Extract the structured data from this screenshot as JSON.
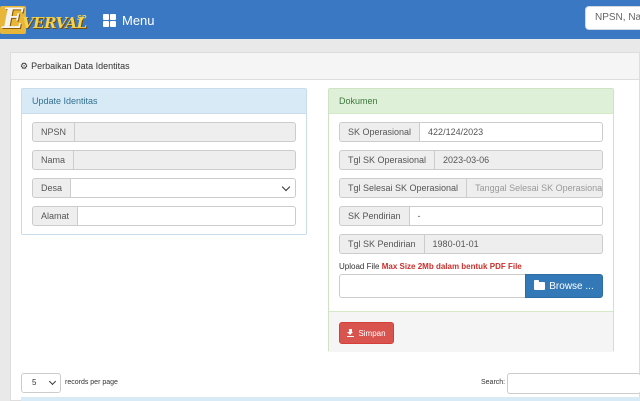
{
  "navbar": {
    "logo_letter": "E",
    "logo_text": "VERVAL",
    "logo_sup": "SP",
    "menu_label": "Menu",
    "search_placeholder": "NPSN, Nama"
  },
  "page": {
    "heading": "Perbaikan Data Identitas"
  },
  "update_identitas": {
    "title": "Update Identitas",
    "fields": [
      {
        "label": "NPSN",
        "value": ""
      },
      {
        "label": "Nama",
        "value": ""
      },
      {
        "label": "Desa",
        "value": ""
      },
      {
        "label": "Alamat",
        "value": ""
      }
    ]
  },
  "dokumen": {
    "title": "Dokumen",
    "fields": [
      {
        "label": "SK Operasional",
        "value": "422/124/2023"
      },
      {
        "label": "Tgl SK Operasional",
        "value": "2023-03-06"
      },
      {
        "label": "Tgl Selesai SK Operasional",
        "placeholder": "Tanggal Selesai SK Operasional..."
      },
      {
        "label": "SK Pendirian",
        "value": "-"
      },
      {
        "label": "Tgl SK Pendirian",
        "value": "1980-01-01"
      }
    ],
    "upload_label": "Upload File",
    "upload_warning": "Max Size 2Mb dalam bentuk PDF File",
    "browse_label": "Browse ...",
    "save_label": "Simpan"
  },
  "table_controls": {
    "records_per_page": "5",
    "records_per_page_label": "records per page",
    "search_label": "Search:"
  },
  "colors": {
    "navbar": "#3a78c3",
    "info_head": "#d9eaf7",
    "success_head": "#dff0d8",
    "primary_btn": "#3479b7",
    "danger_btn": "#d9534f"
  }
}
